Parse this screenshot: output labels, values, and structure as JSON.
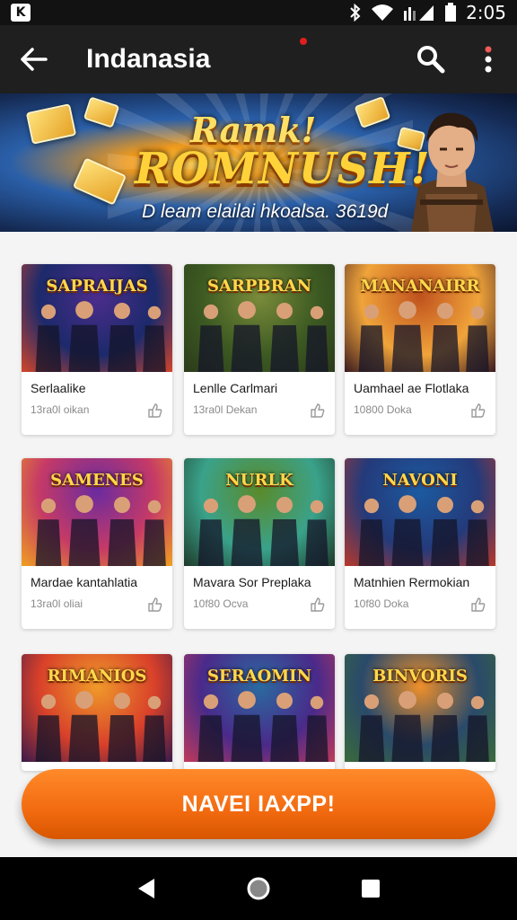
{
  "status_bar": {
    "app_badge": "K",
    "icons": [
      "bluetooth-icon",
      "wifi-icon",
      "signal-icon",
      "battery-icon"
    ],
    "time": "2:05"
  },
  "app_bar": {
    "title": "Indanasia",
    "back_icon": "arrow-left-icon",
    "search_icon": "search-icon",
    "more_icon": "more-vertical-icon"
  },
  "banner": {
    "title_line1": "Ramk!",
    "title_line2": "ROMNUSH!",
    "tagline": "D leam elailai hkoalsa. 3619d"
  },
  "games": [
    {
      "art_title": "SAPRAIJAS",
      "title": "Serlaalike",
      "subtitle": "13ra0l oikan",
      "palette": [
        "#1c2a6b",
        "#4c2c8c",
        "#d3452a"
      ]
    },
    {
      "art_title": "SARPBRAN",
      "title": "Lenlle Carlmari",
      "subtitle": "13ra0l Dekan",
      "palette": [
        "#3d5a22",
        "#7a8b3a",
        "#2b3b1a"
      ]
    },
    {
      "art_title": "MANANAIRR",
      "title": "Uamhael ae Flotlaka",
      "subtitle": "10800 Doka",
      "palette": [
        "#f0a43a",
        "#c0521e",
        "#3a1a20"
      ]
    },
    {
      "art_title": "SAMENES",
      "title": "Mardae kantahlatia",
      "subtitle": "13ra0l oliai",
      "palette": [
        "#c63a66",
        "#6a2ba0",
        "#f0a020"
      ]
    },
    {
      "art_title": "NURLK",
      "title": "Mavara Sor Preplaka",
      "subtitle": "10f80 Ocva",
      "palette": [
        "#3aa28a",
        "#5a8a2a",
        "#1e3a2a"
      ]
    },
    {
      "art_title": "NAVONI",
      "title": "Matnhien Rermokian",
      "subtitle": "10f80 Doka",
      "palette": [
        "#243a7a",
        "#1c5aa0",
        "#b8382a"
      ]
    },
    {
      "art_title": "RIMANIOS",
      "title": "",
      "subtitle": "",
      "palette": [
        "#d8402a",
        "#f09a2a",
        "#3a1a4a"
      ]
    },
    {
      "art_title": "SERAOMIN",
      "title": "",
      "subtitle": "",
      "palette": [
        "#4a2a8a",
        "#2a6aa0",
        "#c03a5a"
      ]
    },
    {
      "art_title": "BINVORIS",
      "title": "",
      "subtitle": "",
      "palette": [
        "#2a4a6a",
        "#f0902a",
        "#3a6a3a"
      ]
    }
  ],
  "cta": {
    "label": "NAVEI IAXPP!"
  },
  "nav": {
    "back": "back-triangle-icon",
    "home": "home-circle-icon",
    "recents": "recents-square-icon"
  }
}
